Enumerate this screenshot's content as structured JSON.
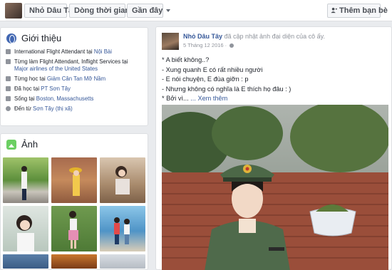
{
  "topbar": {
    "name_label": "Nhỏ Dâu Tây",
    "timeline_label": "Dòng thời gian",
    "recent_label": "Gần đây",
    "add_friend_label": "Thêm bạn bè"
  },
  "intro": {
    "title": "Giới thiệu",
    "items": [
      {
        "prefix": "International Flight Attendant tại ",
        "link": "Nội Bài",
        "icon": "briefcase-icon"
      },
      {
        "prefix": "Từng làm Flight Attendant, Inflight Services tại ",
        "link": "Major airlines of the United States",
        "icon": "briefcase-icon"
      },
      {
        "prefix": "Từng học tại ",
        "link": "Giảm Cân Tan Mỡ Nầm",
        "icon": "graduation-cap-icon"
      },
      {
        "prefix": "Đã học tại ",
        "link": "PT Sơn Tây",
        "icon": "graduation-cap-icon"
      },
      {
        "prefix": "Sống tại ",
        "link": "Boston, Massachusetts",
        "icon": "home-icon"
      },
      {
        "prefix": "Đến từ ",
        "link": "Sơn Tây (thị xã)",
        "icon": "location-pin-icon"
      }
    ]
  },
  "photos": {
    "title": "Ảnh"
  },
  "post": {
    "author": "Nhỏ Dâu Tây",
    "action": " đã cập nhật ảnh đại diện của cô ấy.",
    "date": "5 Tháng 12 2016 · ",
    "lines": [
      "* A biết không..?",
      "- Xung quanh E có rất nhiều người",
      "- E nói chuyện, E đùa giỡn : p",
      "- Nhưng không có nghĩa là E thích họ đâu : )"
    ],
    "last_line": "* Bởi vì... ",
    "see_more": "... Xem thêm"
  }
}
